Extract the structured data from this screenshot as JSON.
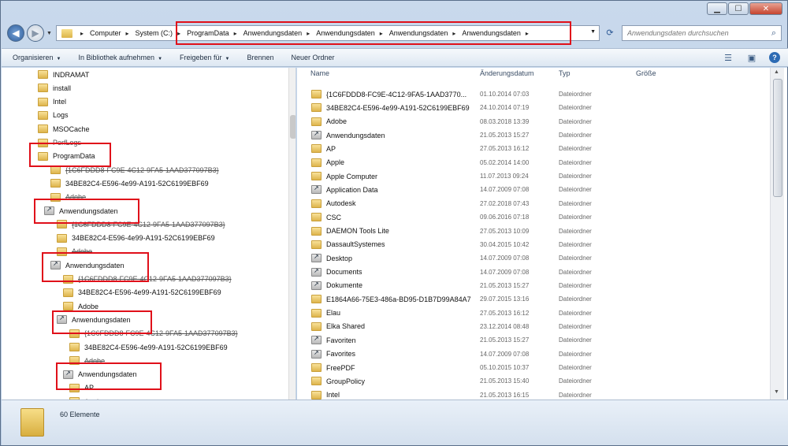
{
  "window": {
    "minimize": "▁",
    "maximize": "☐",
    "close": "✕"
  },
  "address": {
    "crumbs": [
      "Computer",
      "System (C:)",
      "ProgramData",
      "Anwendungsdaten",
      "Anwendungsdaten",
      "Anwendungsdaten",
      "Anwendungsdaten"
    ],
    "search_placeholder": "Anwendungsdaten durchsuchen"
  },
  "toolbar": {
    "organize": "Organisieren",
    "include_library": "In Bibliothek aufnehmen",
    "share": "Freigeben für",
    "burn": "Brennen",
    "new_folder": "Neuer Ordner"
  },
  "tree": [
    {
      "label": "INDRAMAT",
      "icon": "folder-icon",
      "cut": false
    },
    {
      "label": "install",
      "icon": "folder-icon",
      "cut": false
    },
    {
      "label": "Intel",
      "icon": "folder-icon",
      "cut": false
    },
    {
      "label": "Logs",
      "icon": "folder-icon",
      "cut": false
    },
    {
      "label": "MSOCache",
      "icon": "folder-icon",
      "cut": false
    },
    {
      "label": "PerfLogs",
      "icon": "folder-icon",
      "cut": true
    },
    {
      "label": "ProgramData",
      "icon": "folder-icon",
      "cut": false
    },
    {
      "label": "{1C6FDDD8-FC9E-4C12-9FA5-1AAD377097B3}",
      "icon": "folder-icon",
      "cut": true
    },
    {
      "label": "34BE82C4-E596-4e99-A191-52C6199EBF69",
      "icon": "folder-icon",
      "cut": false
    },
    {
      "label": "Adobe",
      "icon": "folder-icon",
      "cut": true
    },
    {
      "label": "Anwendungsdaten",
      "icon": "shortcut-folder-icon",
      "cut": false
    },
    {
      "label": "{1C6FDDD8-FC9E-4C12-9FA5-1AAD377097B3}",
      "icon": "folder-icon",
      "cut": true
    },
    {
      "label": "34BE82C4-E596-4e99-A191-52C6199EBF69",
      "icon": "folder-icon",
      "cut": false
    },
    {
      "label": "Adobe",
      "icon": "folder-icon",
      "cut": true
    },
    {
      "label": "Anwendungsdaten",
      "icon": "shortcut-folder-icon",
      "cut": false
    },
    {
      "label": "{1C6FDDD8-FC9E-4C12-9FA5-1AAD377097B3}",
      "icon": "folder-icon",
      "cut": true
    },
    {
      "label": "34BE82C4-E596-4e99-A191-52C6199EBF69",
      "icon": "folder-icon",
      "cut": false
    },
    {
      "label": "Adobe",
      "icon": "folder-icon",
      "cut": false
    },
    {
      "label": "Anwendungsdaten",
      "icon": "shortcut-folder-icon",
      "cut": false
    },
    {
      "label": "{1C6FDDD8-FC9E-4C12-9FA5-1AAD377097B3}",
      "icon": "folder-icon",
      "cut": true
    },
    {
      "label": "34BE82C4-E596-4e99-A191-52C6199EBF69",
      "icon": "folder-icon",
      "cut": false
    },
    {
      "label": "Adobe",
      "icon": "folder-icon",
      "cut": true
    },
    {
      "label": "Anwendungsdaten",
      "icon": "shortcut-folder-icon",
      "cut": false
    },
    {
      "label": "AP",
      "icon": "folder-icon",
      "cut": false
    },
    {
      "label": "Apple",
      "icon": "folder-icon",
      "cut": true
    }
  ],
  "columns": {
    "name": "Name",
    "date": "Änderungsdatum",
    "type": "Typ",
    "size": "Größe"
  },
  "files": [
    {
      "name": "{1C6FDDD8-FC9E-4C12-9FA5-1AAD3770...",
      "date": "01.10.2014 07:03",
      "type": "Dateiordner",
      "icon": "folder-icon"
    },
    {
      "name": "34BE82C4-E596-4e99-A191-52C6199EBF69",
      "date": "24.10.2014 07:19",
      "type": "Dateiordner",
      "icon": "folder-icon"
    },
    {
      "name": "Adobe",
      "date": "08.03.2018 13:39",
      "type": "Dateiordner",
      "icon": "folder-icon"
    },
    {
      "name": "Anwendungsdaten",
      "date": "21.05.2013 15:27",
      "type": "Dateiordner",
      "icon": "shortcut-folder-icon"
    },
    {
      "name": "AP",
      "date": "27.05.2013 16:12",
      "type": "Dateiordner",
      "icon": "folder-icon"
    },
    {
      "name": "Apple",
      "date": "05.02.2014 14:00",
      "type": "Dateiordner",
      "icon": "folder-icon"
    },
    {
      "name": "Apple Computer",
      "date": "11.07.2013 09:24",
      "type": "Dateiordner",
      "icon": "folder-icon"
    },
    {
      "name": "Application Data",
      "date": "14.07.2009 07:08",
      "type": "Dateiordner",
      "icon": "shortcut-folder-icon"
    },
    {
      "name": "Autodesk",
      "date": "27.02.2018 07:43",
      "type": "Dateiordner",
      "icon": "folder-icon"
    },
    {
      "name": "CSC",
      "date": "09.06.2016 07:18",
      "type": "Dateiordner",
      "icon": "folder-icon"
    },
    {
      "name": "DAEMON Tools Lite",
      "date": "27.05.2013 10:09",
      "type": "Dateiordner",
      "icon": "folder-icon"
    },
    {
      "name": "DassaultSystemes",
      "date": "30.04.2015 10:42",
      "type": "Dateiordner",
      "icon": "folder-icon"
    },
    {
      "name": "Desktop",
      "date": "14.07.2009 07:08",
      "type": "Dateiordner",
      "icon": "shortcut-folder-icon"
    },
    {
      "name": "Documents",
      "date": "14.07.2009 07:08",
      "type": "Dateiordner",
      "icon": "shortcut-folder-icon"
    },
    {
      "name": "Dokumente",
      "date": "21.05.2013 15:27",
      "type": "Dateiordner",
      "icon": "shortcut-folder-icon"
    },
    {
      "name": "E1864A66-75E3-486a-BD95-D1B7D99A84A7",
      "date": "29.07.2015 13:16",
      "type": "Dateiordner",
      "icon": "folder-icon"
    },
    {
      "name": "Elau",
      "date": "27.05.2013 16:12",
      "type": "Dateiordner",
      "icon": "folder-icon"
    },
    {
      "name": "Elka Shared",
      "date": "23.12.2014 08:48",
      "type": "Dateiordner",
      "icon": "folder-icon"
    },
    {
      "name": "Favoriten",
      "date": "21.05.2013 15:27",
      "type": "Dateiordner",
      "icon": "shortcut-folder-icon"
    },
    {
      "name": "Favorites",
      "date": "14.07.2009 07:08",
      "type": "Dateiordner",
      "icon": "shortcut-folder-icon"
    },
    {
      "name": "FreePDF",
      "date": "05.10.2015 10:37",
      "type": "Dateiordner",
      "icon": "folder-icon"
    },
    {
      "name": "GroupPolicy",
      "date": "21.05.2013 15:40",
      "type": "Dateiordner",
      "icon": "folder-icon"
    },
    {
      "name": "Intel",
      "date": "21.05.2013 16:15",
      "type": "Dateiordner",
      "icon": "folder-icon"
    }
  ],
  "status": {
    "count": "60 Elemente"
  }
}
